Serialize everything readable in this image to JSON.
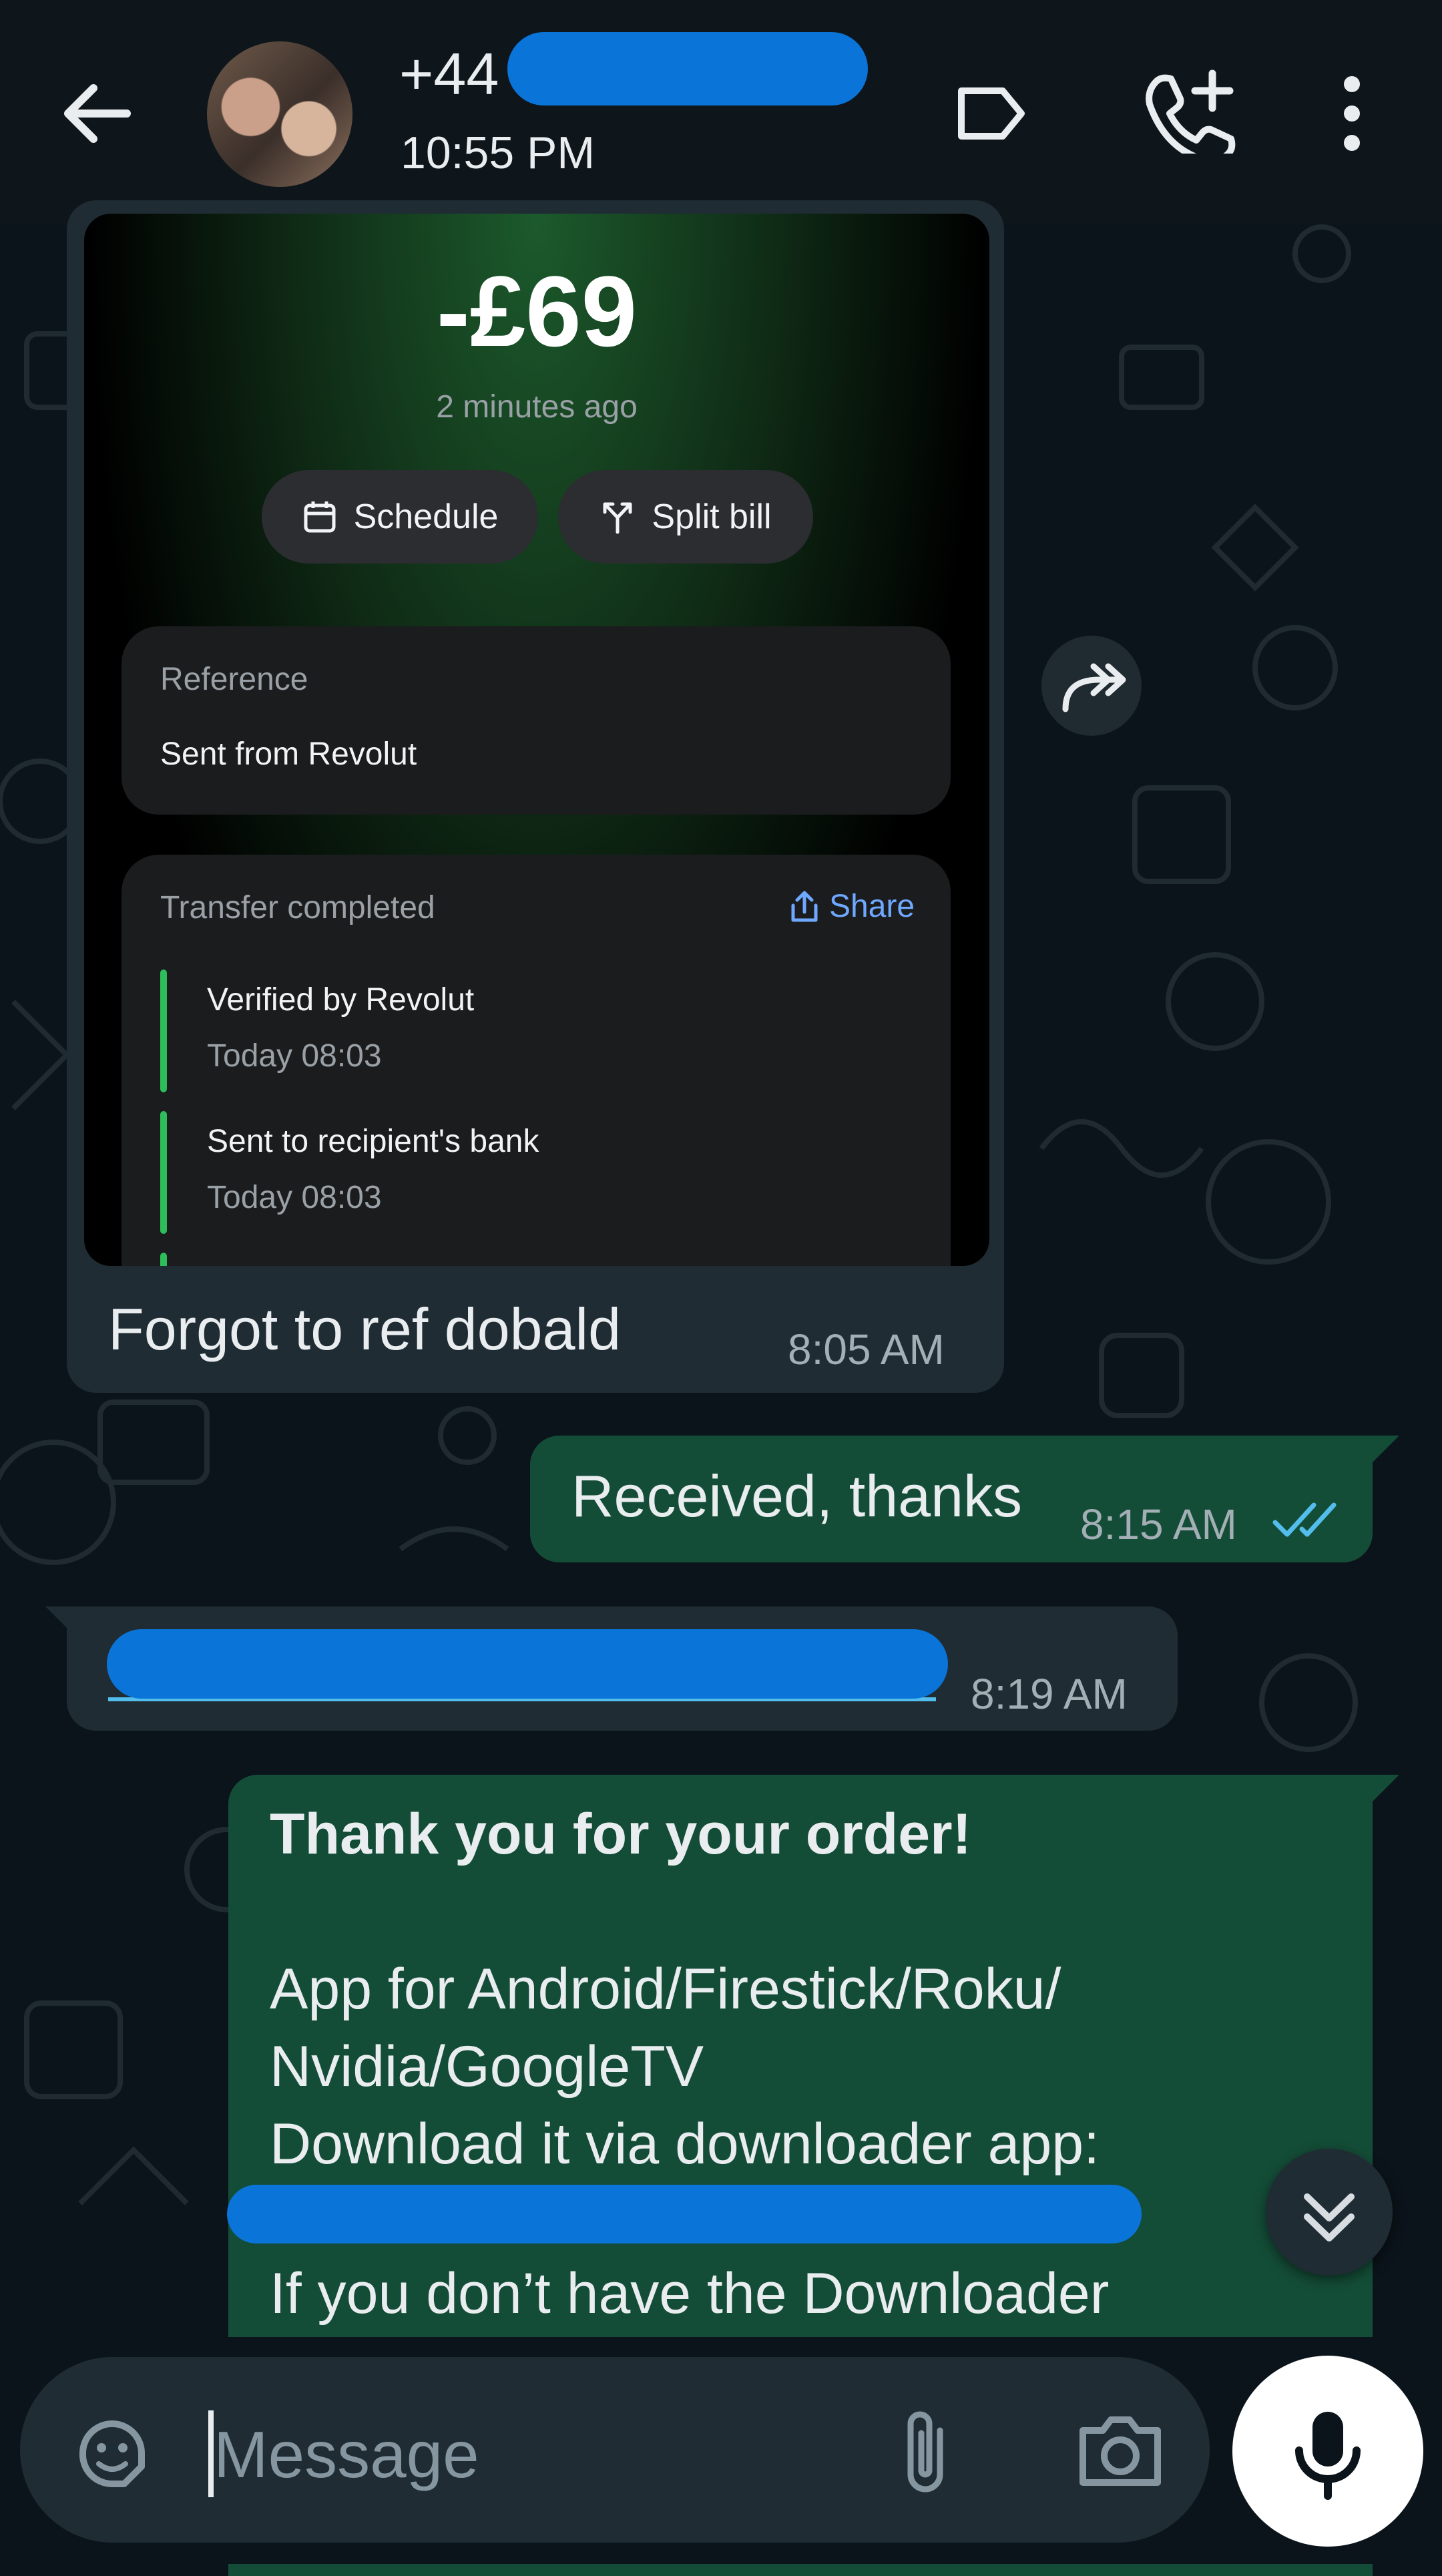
{
  "header": {
    "contact_name": "+44",
    "status": "10:55 PM"
  },
  "transfer_card": {
    "amount": "-£69",
    "time_ago": "2 minutes ago",
    "schedule_label": "Schedule",
    "split_label": "Split bill",
    "reference_label": "Reference",
    "reference_value": "Sent from Revolut",
    "status_label": "Transfer completed",
    "share_label": "Share",
    "steps": [
      {
        "title": "Verified by Revolut",
        "time": "Today 08:03"
      },
      {
        "title": "Sent to recipient's bank",
        "time": "Today 08:03"
      }
    ]
  },
  "messages": {
    "m1_caption": "Forgot to ref dobald",
    "m1_time": "8:05 AM",
    "m2_text": "Received, thanks",
    "m2_time": "8:15 AM",
    "m3_time": "8:19 AM",
    "m4_title": "Thank you for your order!",
    "m4_line1": "App for Android/Firestick/Roku/",
    "m4_line2": "Nvidia/GoogleTV",
    "m4_line3": "Download it via downloader app:",
    "m4_line5": "If you don’t have the Downloader"
  },
  "composer": {
    "placeholder": "Message"
  },
  "colors": {
    "outgoing_bubble": "#144d37",
    "incoming_bubble": "#1f2c34",
    "read_ticks": "#53bdeb",
    "redaction": "#0a74d8"
  }
}
